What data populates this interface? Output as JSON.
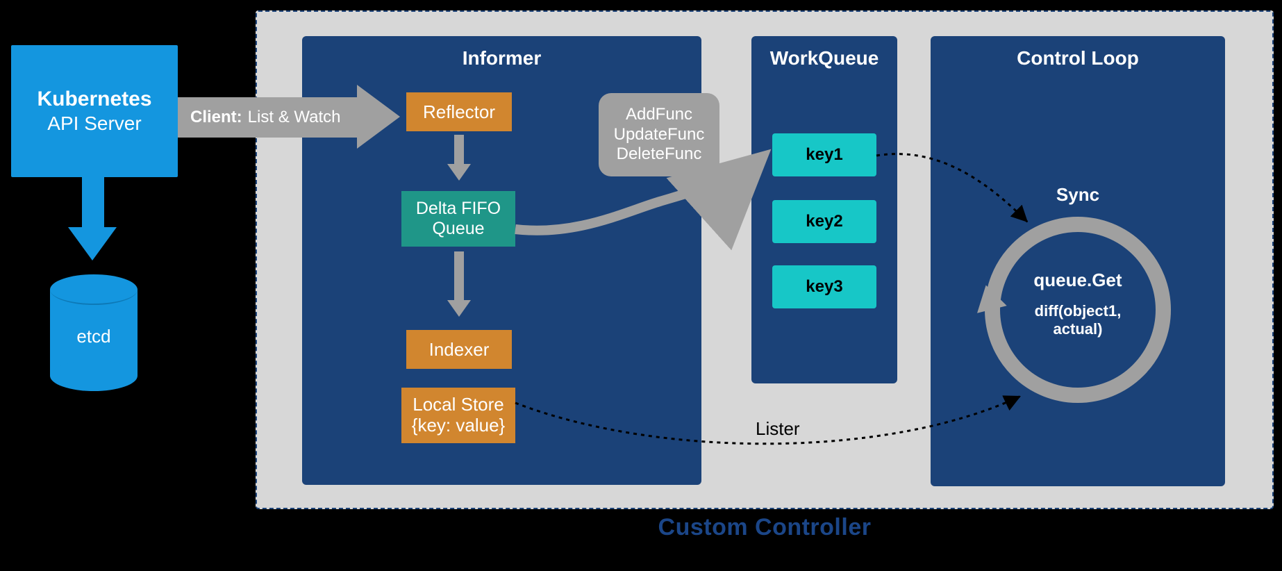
{
  "kubernetes": {
    "title": "Kubernetes",
    "subtitle": "API Server",
    "etcd_label": "etcd"
  },
  "list_watch": {
    "prefix": "Client:",
    "text": "List & Watch"
  },
  "informer": {
    "title": "Informer",
    "reflector": "Reflector",
    "delta_fifo_line1": "Delta FIFO",
    "delta_fifo_line2": "Queue",
    "indexer": "Indexer",
    "local_store_line1": "Local Store",
    "local_store_line2": "{key: value}"
  },
  "callbacks": {
    "add": "AddFunc",
    "update": "UpdateFunc",
    "delete": "DeleteFunc"
  },
  "workqueue": {
    "title": "WorkQueue",
    "keys": [
      "key1",
      "key2",
      "key3"
    ]
  },
  "controlloop": {
    "title": "Control Loop",
    "sync_label": "Sync",
    "queue_get": "queue.Get",
    "diff_line1": "diff(object1,",
    "diff_line2": "actual)"
  },
  "lister_label": "Lister",
  "controller_caption": "Custom Controller"
}
